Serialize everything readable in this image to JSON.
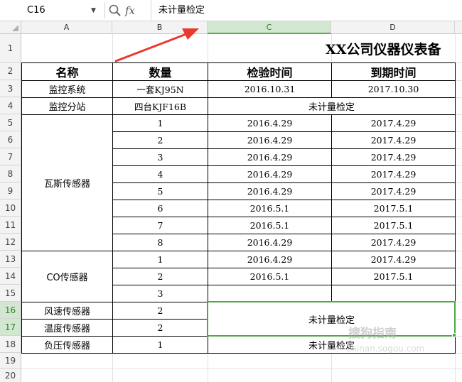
{
  "formula_bar": {
    "name_box": "C16",
    "fx": "fx",
    "content": "未计量检定"
  },
  "columns": [
    "A",
    "B",
    "C",
    "D"
  ],
  "rows": [
    "1",
    "2",
    "3",
    "4",
    "5",
    "6",
    "7",
    "8",
    "9",
    "10",
    "11",
    "12",
    "13",
    "14",
    "15",
    "16",
    "17",
    "18",
    "19",
    "20"
  ],
  "title": "XX公司仪器仪表备",
  "headers": {
    "name": "名称",
    "qty": "数量",
    "check": "检验时间",
    "expire": "到期时间"
  },
  "cells": [
    {
      "name": "监控系统",
      "qty": "一套KJ95N",
      "check": "2016.10.31",
      "expire": "2017.10.30"
    },
    {
      "name": "监控分站",
      "qty": "四台KJF16B",
      "merged": "未计量检定"
    },
    {
      "qty": "1",
      "check": "2016.4.29",
      "expire": "2017.4.29"
    },
    {
      "qty": "2",
      "check": "2016.4.29",
      "expire": "2017.4.29"
    },
    {
      "qty": "3",
      "check": "2016.4.29",
      "expire": "2017.4.29"
    },
    {
      "qty": "4",
      "check": "2016.4.29",
      "expire": "2017.4.29"
    },
    {
      "qty": "5",
      "check": "2016.4.29",
      "expire": "2017.4.29"
    },
    {
      "qty": "6",
      "check": "2016.5.1",
      "expire": "2017.5.1"
    },
    {
      "qty": "7",
      "check": "2016.5.1",
      "expire": "2017.5.1"
    },
    {
      "qty": "8",
      "check": "2016.4.29",
      "expire": "2017.4.29"
    },
    {
      "qty": "1",
      "check": "2016.4.29",
      "expire": "2017.4.29"
    },
    {
      "qty": "2",
      "check": "2016.5.1",
      "expire": "2017.5.1"
    },
    {
      "qty": "3"
    },
    {
      "name": "风速传感器",
      "qty": "2"
    },
    {
      "name": "温度传感器",
      "qty": "2"
    },
    {
      "name": "负压传感器",
      "qty": "1",
      "merged": "未计量检定"
    }
  ],
  "groups": {
    "gas": "瓦斯传感器",
    "co": "CO传感器",
    "merged_16_17": "未计量检定"
  },
  "watermark": "搜狗指南",
  "watermark_sub": "zhinan.sogou.com",
  "colors": {
    "selection": "#4fa846",
    "arrow": "#e8392f"
  }
}
